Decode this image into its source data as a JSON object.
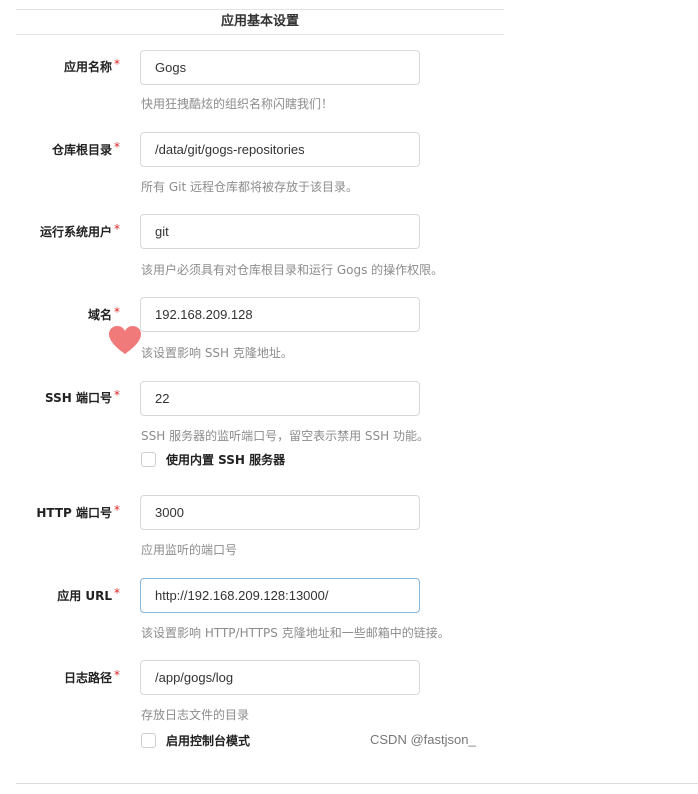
{
  "section": {
    "title": "应用基本设置"
  },
  "fields": {
    "app_name": {
      "label": "应用名称",
      "required": "*",
      "value": "Gogs",
      "help": "快用狂拽酷炫的组织名称闪瞎我们！"
    },
    "repo_root": {
      "label": "仓库根目录",
      "required": "*",
      "value": "/data/git/gogs-repositories",
      "help": "所有 Git 远程仓库都将被存放于该目录。"
    },
    "run_user": {
      "label": "运行系统用户",
      "required": "*",
      "value": "git",
      "help": "该用户必须具有对仓库根目录和运行 Gogs 的操作权限。"
    },
    "domain": {
      "label": "域名",
      "required": "*",
      "value": "192.168.209.128",
      "help": "该设置影响 SSH 克隆地址。"
    },
    "ssh_port": {
      "label": "SSH 端口号",
      "required": "*",
      "value": "22",
      "help": "SSH 服务器的监听端口号，留空表示禁用 SSH 功能。",
      "checkbox_label": "使用内置 SSH 服务器"
    },
    "http_port": {
      "label": "HTTP 端口号",
      "required": "*",
      "value": "3000",
      "help": "应用监听的端口号"
    },
    "app_url": {
      "label": "应用 URL",
      "required": "*",
      "value": "http://192.168.209.128:13000/",
      "help": "该设置影响 HTTP/HTTPS 克隆地址和一些邮箱中的链接。"
    },
    "log_path": {
      "label": "日志路径",
      "required": "*",
      "value": "/app/gogs/log",
      "help": "存放日志文件的目录",
      "checkbox_label": "启用控制台模式"
    }
  },
  "watermark": "CSDN @fastjson_",
  "colors": {
    "required": "#db2828",
    "heart": "#f07a7a",
    "focus_border": "#85b7d9"
  }
}
